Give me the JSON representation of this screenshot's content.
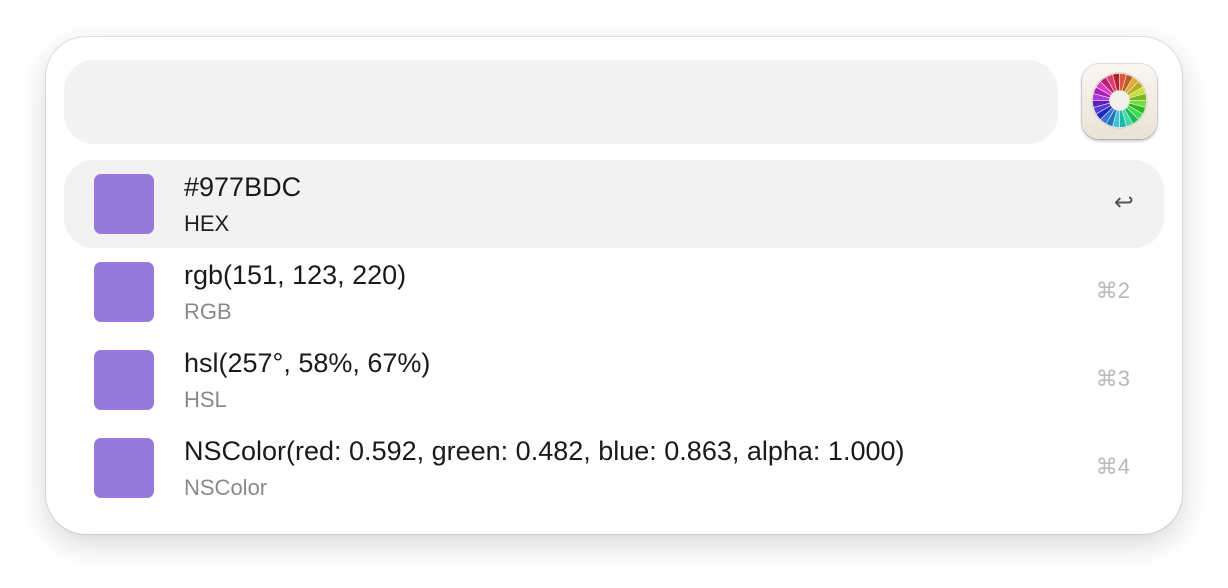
{
  "search": {
    "value": "",
    "placeholder": ""
  },
  "app": {
    "icon": "color-wheel-icon"
  },
  "accent": "#977BDC",
  "results": [
    {
      "value": "#977BDC",
      "format": "HEX",
      "shortcut": "↩",
      "selected": true,
      "swatch": "#977BDC"
    },
    {
      "value": "rgb(151, 123, 220)",
      "format": "RGB",
      "shortcut": "⌘2",
      "selected": false,
      "swatch": "#977BDC"
    },
    {
      "value": "hsl(257°, 58%, 67%)",
      "format": "HSL",
      "shortcut": "⌘3",
      "selected": false,
      "swatch": "#977BDC"
    },
    {
      "value": "NSColor(red: 0.592, green: 0.482, blue: 0.863, alpha: 1.000)",
      "format": "NSColor",
      "shortcut": "⌘4",
      "selected": false,
      "swatch": "#977BDC"
    }
  ]
}
